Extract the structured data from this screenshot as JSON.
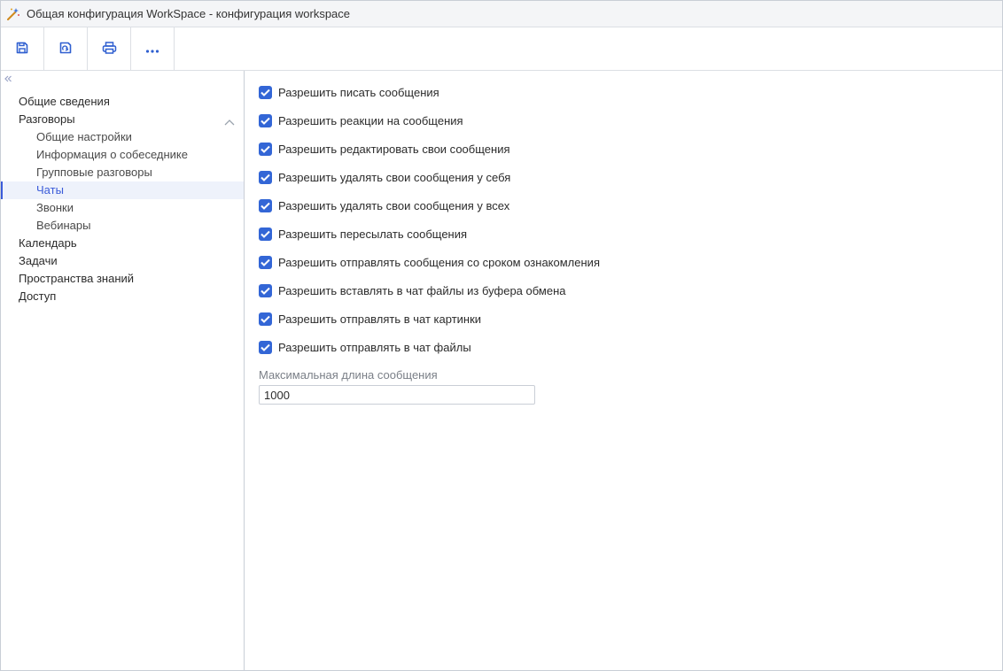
{
  "window": {
    "title": "Общая конфигурация WorkSpace - конфигурация workspace"
  },
  "toolbar": {
    "buttons": [
      {
        "icon": "save-icon"
      },
      {
        "icon": "save-refresh-icon"
      },
      {
        "icon": "print-icon"
      },
      {
        "icon": "more-icon"
      }
    ]
  },
  "sidebar": {
    "items": [
      {
        "label": "Общие сведения",
        "level": 0
      },
      {
        "label": "Разговоры",
        "level": 0,
        "expanded": true
      },
      {
        "label": "Общие настройки",
        "level": 1
      },
      {
        "label": "Информация о собеседнике",
        "level": 1
      },
      {
        "label": "Групповые разговоры",
        "level": 1
      },
      {
        "label": "Чаты",
        "level": 1,
        "active": true
      },
      {
        "label": "Звонки",
        "level": 1
      },
      {
        "label": "Вебинары",
        "level": 1
      },
      {
        "label": "Календарь",
        "level": 0
      },
      {
        "label": "Задачи",
        "level": 0
      },
      {
        "label": "Пространства знаний",
        "level": 0
      },
      {
        "label": "Доступ",
        "level": 0
      }
    ]
  },
  "settings": {
    "checkboxes": [
      {
        "label": "Разрешить писать сообщения",
        "checked": true
      },
      {
        "label": "Разрешить реакции на сообщения",
        "checked": true
      },
      {
        "label": "Разрешить редактировать свои сообщения",
        "checked": true
      },
      {
        "label": "Разрешить удалять свои сообщения у себя",
        "checked": true
      },
      {
        "label": "Разрешить удалять свои сообщения у всех",
        "checked": true
      },
      {
        "label": "Разрешить пересылать сообщения",
        "checked": true
      },
      {
        "label": "Разрешить отправлять сообщения со сроком ознакомления",
        "checked": true
      },
      {
        "label": "Разрешить вставлять в чат файлы из буфера обмена",
        "checked": true
      },
      {
        "label": "Разрешить отправлять в чат картинки",
        "checked": true
      },
      {
        "label": "Разрешить отправлять в чат файлы",
        "checked": true
      }
    ],
    "max_length": {
      "label": "Максимальная длина сообщения",
      "value": "1000"
    }
  },
  "colors": {
    "accent": "#3366d6",
    "active_nav": "#3a5bd9",
    "border": "#c9ced6"
  }
}
